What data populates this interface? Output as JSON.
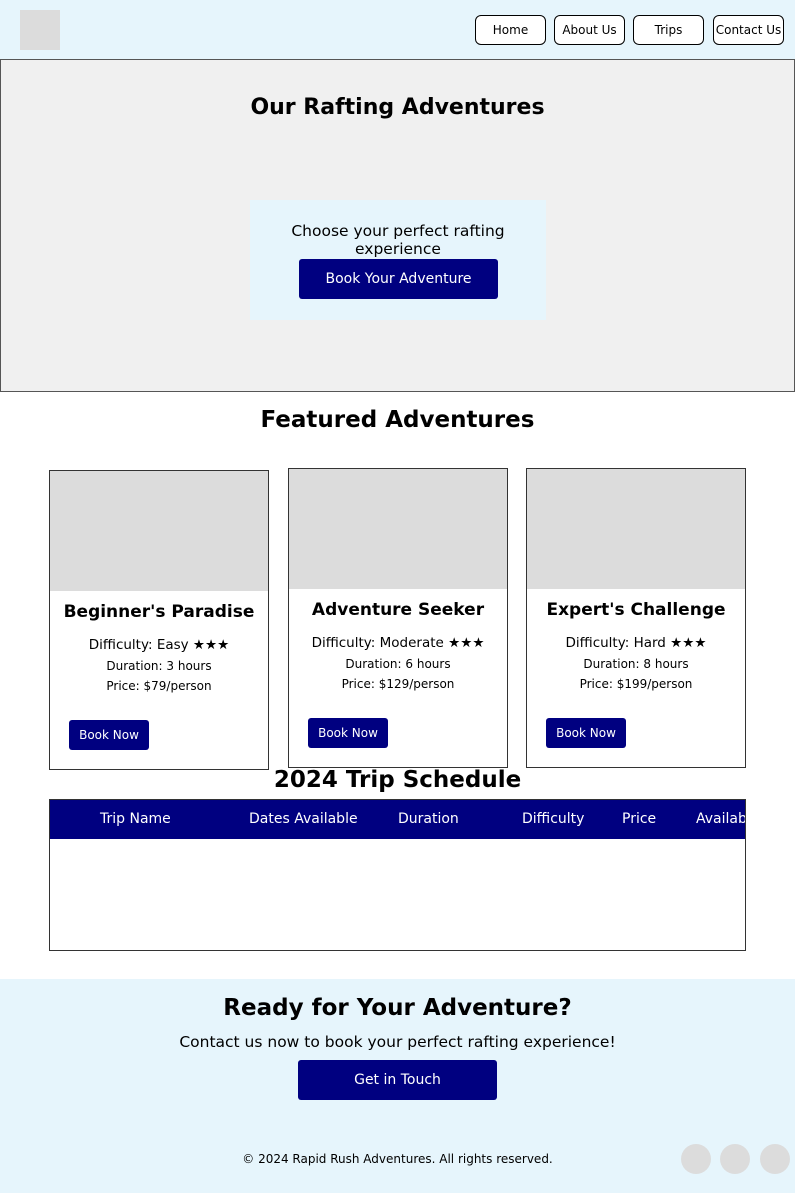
{
  "header": {
    "logo": "logo-placeholder",
    "nav": [
      {
        "label": "Home"
      },
      {
        "label": "About Us"
      },
      {
        "label": "Trips"
      },
      {
        "label": "Contact Us"
      }
    ]
  },
  "hero": {
    "title": "Our Rafting Adventures",
    "subtitle": "Choose your perfect rafting experience",
    "button": "Book Your Adventure"
  },
  "featured": {
    "title": "Featured Adventures",
    "cards": [
      {
        "title": "Beginner's Paradise",
        "difficulty": "Difficulty: Easy ★★★",
        "duration": "Duration: 3 hours",
        "price": "Price: $79/person",
        "button": "Book Now"
      },
      {
        "title": "Adventure Seeker",
        "difficulty": "Difficulty: Moderate ★★★",
        "duration": "Duration: 6 hours",
        "price": "Price: $129/person",
        "button": "Book Now"
      },
      {
        "title": "Expert's Challenge",
        "difficulty": "Difficulty: Hard ★★★",
        "duration": "Duration: 8 hours",
        "price": "Price: $199/person",
        "button": "Book Now"
      }
    ]
  },
  "schedule": {
    "title": "2024 Trip Schedule",
    "columns": [
      "Trip Name",
      "Dates Available",
      "Duration",
      "Difficulty",
      "Price",
      "Availability"
    ],
    "rows": []
  },
  "cta": {
    "title": "Ready for Your Adventure?",
    "subtitle": "Contact us now to book your perfect rafting experience!",
    "button": "Get in Touch"
  },
  "footer": {
    "copyright": "© 2024 Rapid Rush Adventures. All rights reserved."
  },
  "colors": {
    "primary": "#000080",
    "light_bg": "#e6f5fc",
    "hero_bg": "#f0f0f0",
    "placeholder": "#dcdcdc"
  }
}
